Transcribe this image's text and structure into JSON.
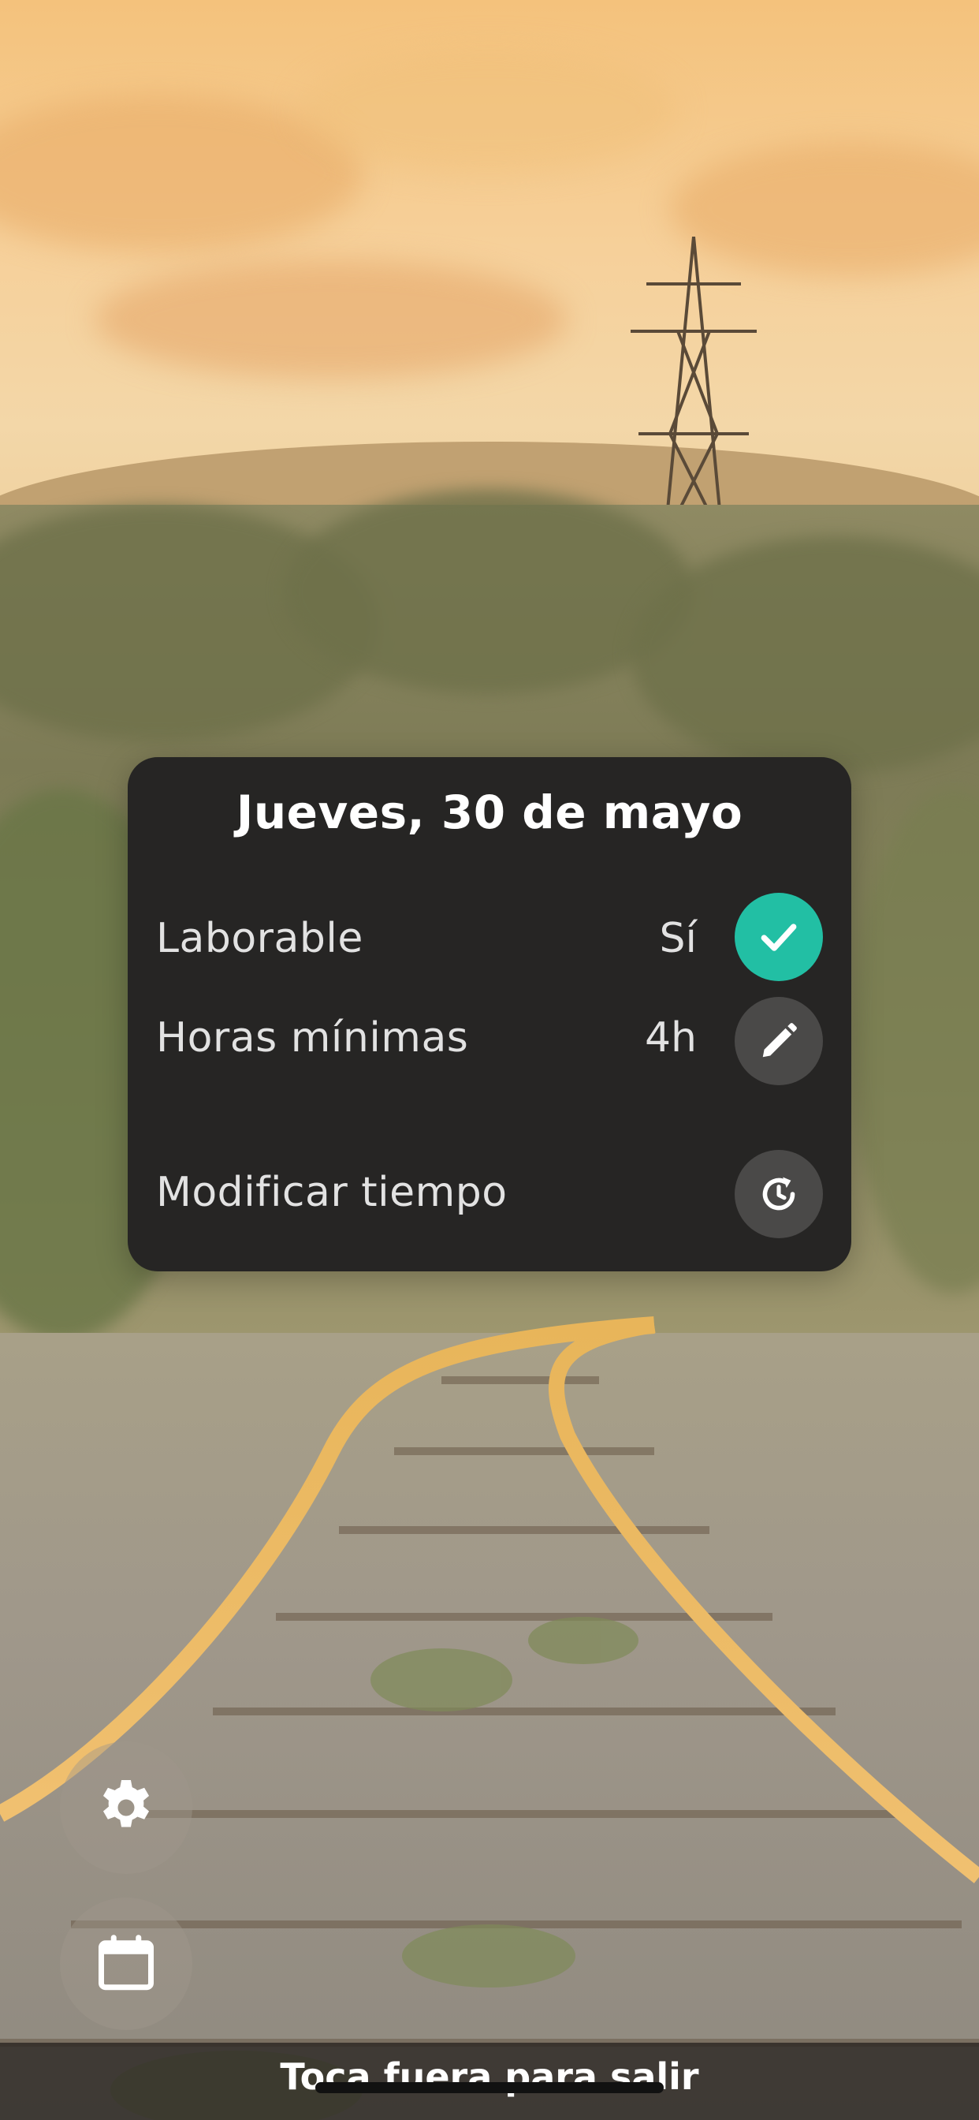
{
  "dialog": {
    "title": "Jueves, 30 de mayo",
    "rows": [
      {
        "label": "Laborable",
        "value": "Sí",
        "action_icon": "check-icon"
      },
      {
        "label": "Horas mínimas",
        "value": "4h",
        "action_icon": "pencil-icon"
      },
      {
        "label": "Modificar tiempo",
        "value": "",
        "action_icon": "history-clock-icon"
      }
    ]
  },
  "side_buttons": [
    {
      "icon": "gear-icon"
    },
    {
      "icon": "calendar-icon"
    }
  ],
  "hint": "Toca fuera para salir",
  "colors": {
    "card_background": "#262524",
    "accent": "#22bfa4",
    "secondary_button": "#4a4948",
    "text": "#e2e2e2"
  }
}
